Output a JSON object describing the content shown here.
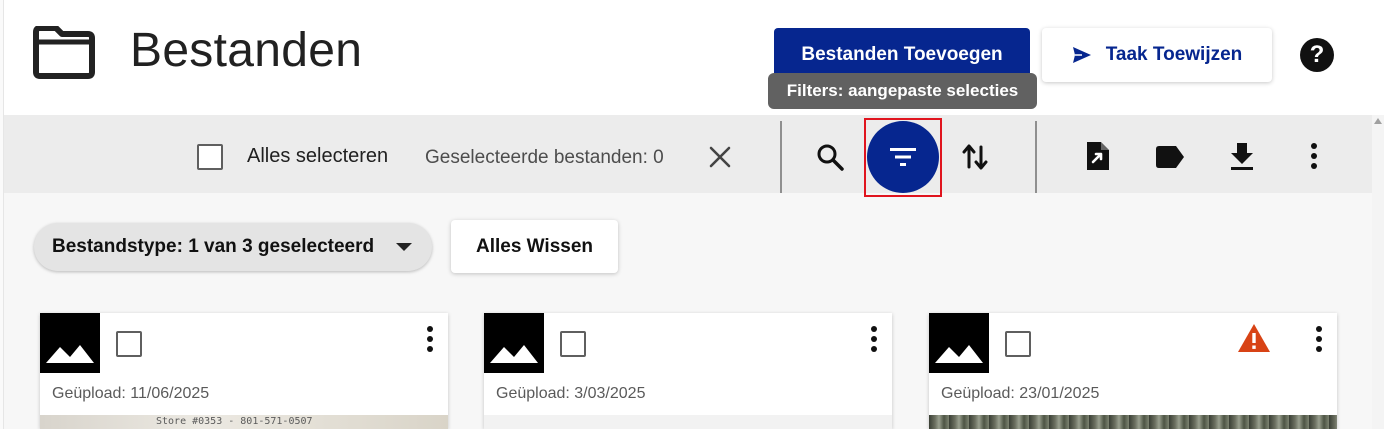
{
  "header": {
    "title": "Bestanden",
    "add_files_label": "Bestanden Toevoegen",
    "assign_task_label": "Taak Toewijzen",
    "help_glyph": "?"
  },
  "tooltip": {
    "text": "Filters: aangepaste selecties"
  },
  "toolbar": {
    "select_all_label": "Alles selecteren",
    "selected_count_label": "Geselecteerde bestanden: 0",
    "icons": [
      "search-icon",
      "filter-icon",
      "sort-icon",
      "export-file-icon",
      "label-icon",
      "download-icon",
      "more-vert-icon"
    ]
  },
  "filters": {
    "file_type_chip": "Bestandstype: 1 van 3 geselecteerd",
    "clear_all_label": "Alles Wissen"
  },
  "cards": [
    {
      "uploaded": "Geüpload: 11/06/2025",
      "has_warning": false,
      "preview_text": "Store #0353 - 801-571-0507"
    },
    {
      "uploaded": "Geüpload: 3/03/2025",
      "has_warning": false
    },
    {
      "uploaded": "Geüpload: 23/01/2025",
      "has_warning": true
    }
  ],
  "colors": {
    "primary": "#06268f",
    "toolbar_bg": "#ececec",
    "tooltip_bg": "#616161",
    "warning": "#d84315",
    "highlight": "#e0141e"
  }
}
